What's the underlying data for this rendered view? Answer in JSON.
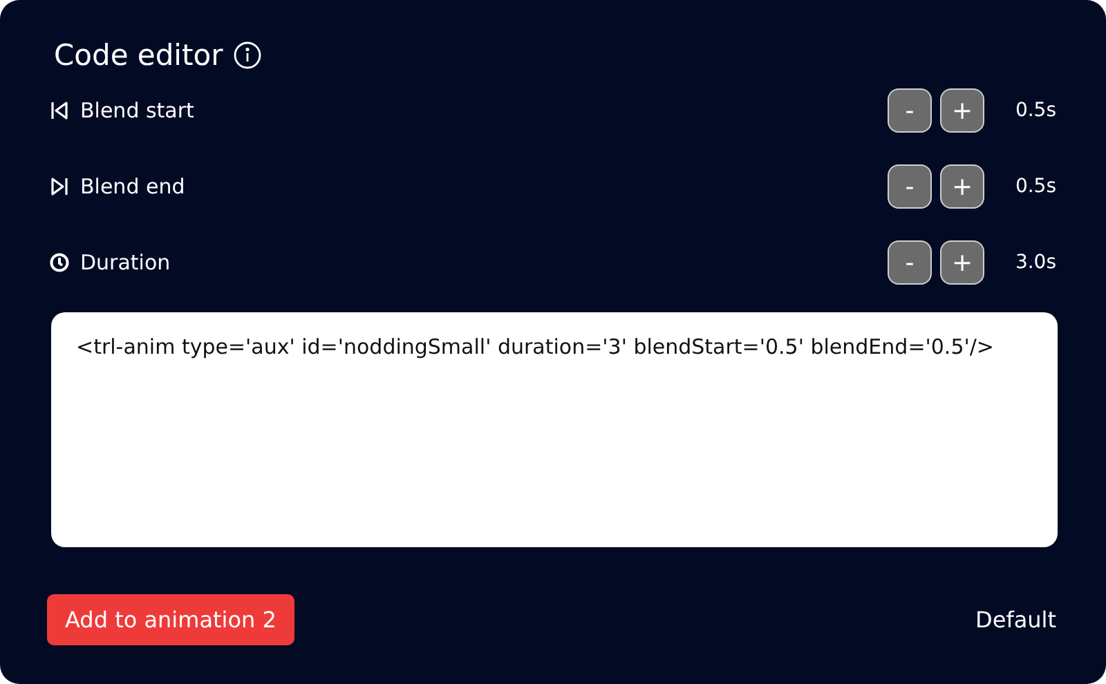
{
  "panel": {
    "title": "Code editor"
  },
  "rows": [
    {
      "kind": "blend_start",
      "label": "Blend start",
      "minus": "-",
      "plus": "+",
      "reading": "0.5s"
    },
    {
      "kind": "blend_end",
      "label": "Blend end",
      "minus": "-",
      "plus": "+",
      "reading": "0.5s"
    },
    {
      "kind": "duration",
      "label": "Duration",
      "minus": "-",
      "plus": "+",
      "reading": "3.0s"
    }
  ],
  "code": {
    "value": "<trl-anim type='aux' id='noddingSmall' duration='3' blendStart='0.5' blendEnd='0.5'/>"
  },
  "footer": {
    "primary_button": "Add to animation 2",
    "link": "Default"
  }
}
